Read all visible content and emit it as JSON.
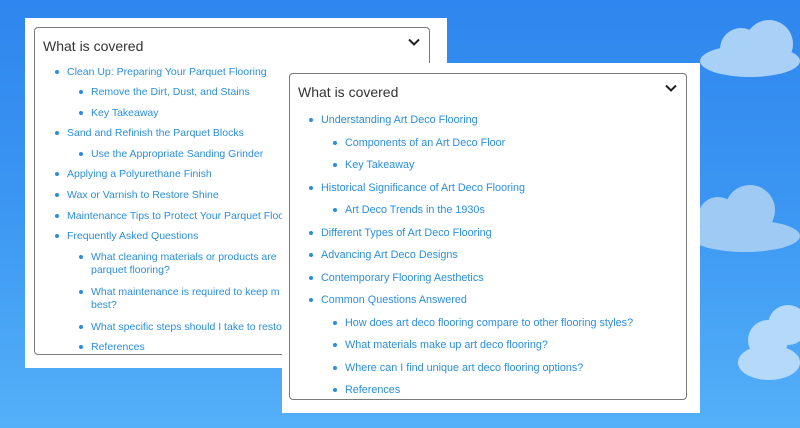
{
  "left_toc": {
    "title": "What is covered",
    "items": [
      "Clean Up: Preparing Your Parquet Flooring",
      "Remove the Dirt, Dust, and Stains",
      "Key Takeaway",
      "Sand and Refinish the Parquet Blocks",
      "Use the Appropriate Sanding Grinder",
      "Applying a Polyurethane Finish",
      "Wax or Varnish to Restore Shine",
      "Maintenance Tips to Protect Your Parquet Floo",
      "Frequently Asked Questions",
      "What cleaning materials or products are\nparquet flooring?",
      "What maintenance is required to keep m\nbest?",
      "What specific steps should I take to resto",
      "References"
    ]
  },
  "right_toc": {
    "title": "What is covered",
    "items": [
      "Understanding Art Deco Flooring",
      "Components of an Art Deco Floor",
      "Key Takeaway",
      "Historical Significance of Art Deco Flooring",
      "Art Deco Trends in the 1930s",
      "Different Types of Art Deco Flooring",
      "Advancing Art Deco Designs",
      "Contemporary Flooring Aesthetics",
      "Common Questions Answered",
      "How does art deco flooring compare to other flooring styles?",
      "What materials make up art deco flooring?",
      "Where can I find unique art deco flooring options?",
      "References"
    ]
  },
  "colors": {
    "background": "#3a95f2",
    "link": "#2a8ee0",
    "border": "#7a7a7a"
  },
  "icons": {
    "toggle": "chevron-down-icon",
    "decor": "cloud-icon"
  }
}
